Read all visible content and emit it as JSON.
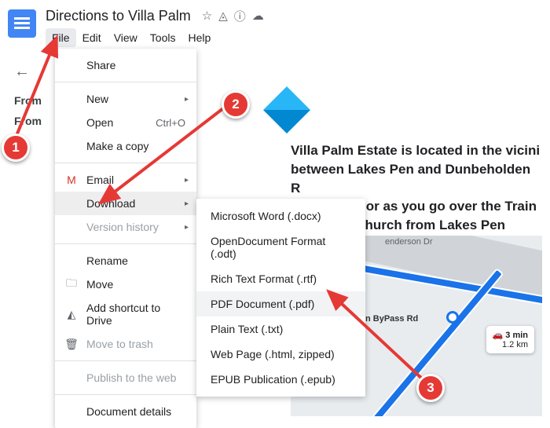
{
  "header": {
    "doc_title": "Directions to Villa Palm",
    "menus": [
      "File",
      "Edit",
      "View",
      "Tools",
      "Help"
    ],
    "active_menu_index": 0
  },
  "outline": {
    "items": [
      "From",
      "From"
    ]
  },
  "file_menu": {
    "share": "Share",
    "new": "New",
    "open": "Open",
    "open_shortcut": "Ctrl+O",
    "make_copy": "Make a copy",
    "email": "Email",
    "download": "Download",
    "version_history": "Version history",
    "rename": "Rename",
    "move": "Move",
    "add_shortcut": "Add shortcut to Drive",
    "move_to_trash": "Move to trash",
    "publish": "Publish to the web",
    "details": "Document details"
  },
  "download_submenu": {
    "items": [
      "Microsoft Word (.docx)",
      "OpenDocument Format (.odt)",
      "Rich Text Format (.rtf)",
      "PDF Document (.pdf)",
      "Plain Text (.txt)",
      "Web Page (.html, zipped)",
      "EPUB Publication (.epub)"
    ],
    "hover_index": 3
  },
  "document_body": {
    "text": "Villa Palm Estate is located in the vicini\nbetween Lakes Pen and Dunbeholden R\nWarehouse or as you go over the Train \nassembly Church from Lakes Pen"
  },
  "map": {
    "road_labels": [
      "enderson Dr",
      "n ByPass Rd"
    ],
    "bubble_time": "3 min",
    "bubble_dist": "1.2 km"
  },
  "callouts": [
    "1",
    "2",
    "3"
  ]
}
